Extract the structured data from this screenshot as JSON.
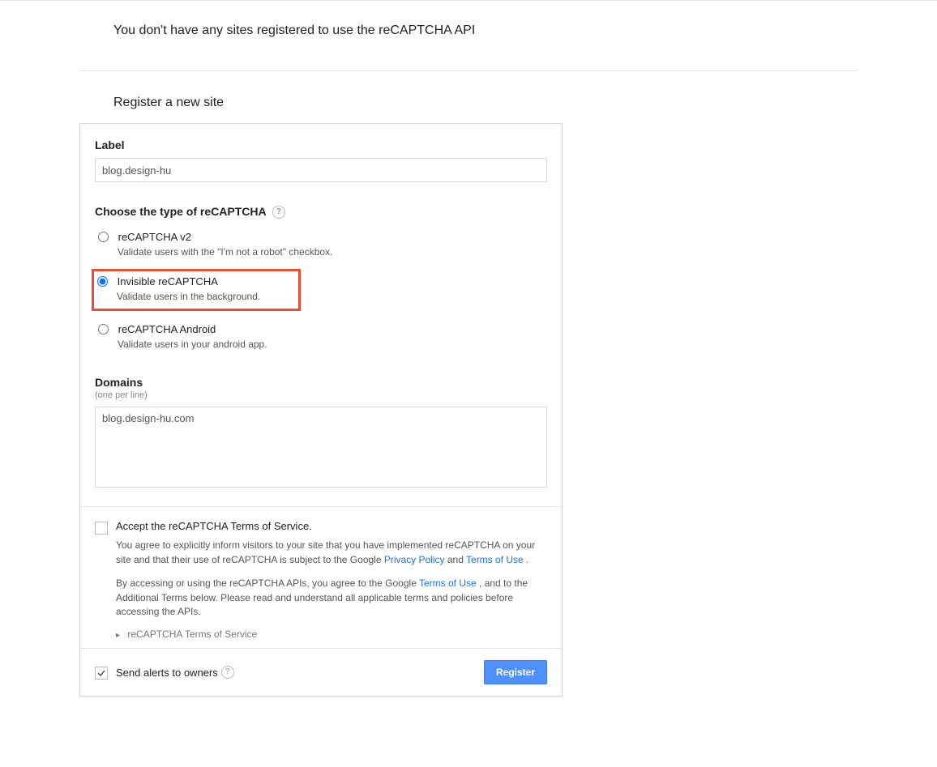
{
  "hero": {
    "message": "You don't have any sites registered to use the reCAPTCHA API"
  },
  "section_title": "Register a new site",
  "form": {
    "label_header": "Label",
    "label_value": "blog.design-hu",
    "type_header": "Choose the type of reCAPTCHA",
    "options": [
      {
        "title": "reCAPTCHA v2",
        "desc": "Validate users with the \"I'm not a robot\" checkbox.",
        "selected": false,
        "highlight": false
      },
      {
        "title": "Invisible reCAPTCHA",
        "desc": "Validate users in the background.",
        "selected": true,
        "highlight": true
      },
      {
        "title": "reCAPTCHA Android",
        "desc": "Validate users in your android app.",
        "selected": false,
        "highlight": false
      }
    ],
    "domains_header": "Domains",
    "domains_hint": "(one per line)",
    "domains_value": "blog.design-hu.com"
  },
  "tos": {
    "accept_label": "Accept the reCAPTCHA Terms of Service.",
    "para1_pre": "You agree to explicitly inform visitors to your site that you have implemented reCAPTCHA on your site and that their use of reCAPTCHA is subject to the Google ",
    "privacy_link": "Privacy Policy",
    "and1": " and ",
    "terms_link1": "Terms of Use",
    "period1": ".",
    "para2_pre": "By accessing or using the reCAPTCHA APIs, you agree to the Google ",
    "terms_link2": "Terms of Use",
    "para2_post": ", and to the Additional Terms below. Please read and understand all applicable terms and policies before accessing the APIs.",
    "expand_label": "reCAPTCHA Terms of Service"
  },
  "footer": {
    "alerts_label": "Send alerts to owners",
    "register_label": "Register"
  }
}
